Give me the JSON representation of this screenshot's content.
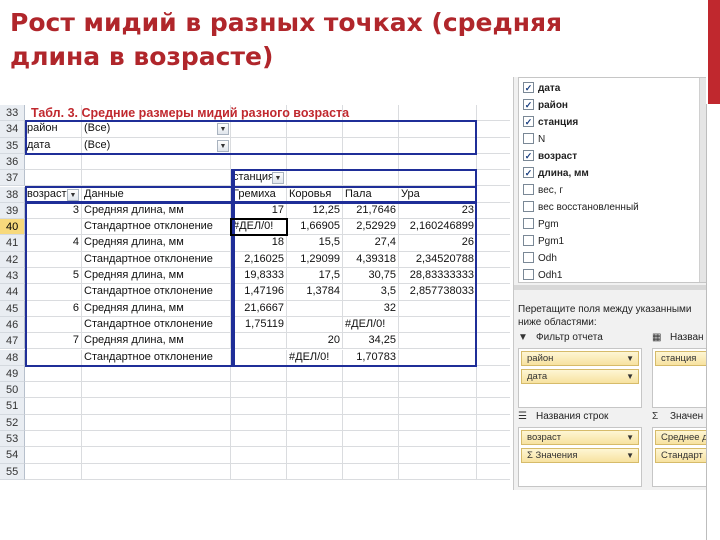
{
  "slide": {
    "title": "Рост мидий в разных точках (средняя длина в возрасте)"
  },
  "sheet": {
    "pivot_title": "Табл. 3. Средние размеры мидий разного возраста",
    "filters": [
      {
        "row": "34",
        "field": "район",
        "value": "(Все)"
      },
      {
        "row": "35",
        "field": "дата",
        "value": "(Все)"
      }
    ],
    "blank_rows": [
      "33",
      "36"
    ],
    "col_field_row": {
      "row": "37",
      "label": "станция"
    },
    "header_row": {
      "row": "38",
      "row_field": "возраст",
      "data_label": "Данные",
      "columns": [
        "Гремиха",
        "Коровья",
        "Пала",
        "Ура"
      ]
    },
    "data_rows": [
      {
        "row": "39",
        "age": "3",
        "measure": "Средняя длина, мм",
        "values": [
          "17",
          "12,25",
          "21,7646",
          "23"
        ]
      },
      {
        "row": "40",
        "age": "",
        "measure": "Стандартное отклонение",
        "values": [
          "#ДЕЛ/0!",
          "1,66905",
          "2,52929",
          "2,160246899"
        ]
      },
      {
        "row": "41",
        "age": "4",
        "measure": "Средняя длина, мм",
        "values": [
          "18",
          "15,5",
          "27,4",
          "26"
        ]
      },
      {
        "row": "42",
        "age": "",
        "measure": "Стандартное отклонение",
        "values": [
          "2,16025",
          "1,29099",
          "4,39318",
          "2,34520788"
        ]
      },
      {
        "row": "43",
        "age": "5",
        "measure": "Средняя длина, мм",
        "values": [
          "19,8333",
          "17,5",
          "30,75",
          "28,83333333"
        ]
      },
      {
        "row": "44",
        "age": "",
        "measure": "Стандартное отклонение",
        "values": [
          "1,47196",
          "1,3784",
          "3,5",
          "2,857738033"
        ]
      },
      {
        "row": "45",
        "age": "6",
        "measure": "Средняя длина, мм",
        "values": [
          "21,6667",
          "",
          "32",
          ""
        ]
      },
      {
        "row": "46",
        "age": "",
        "measure": "Стандартное отклонение",
        "values": [
          "1,75119",
          "",
          "#ДЕЛ/0!",
          ""
        ]
      },
      {
        "row": "47",
        "age": "7",
        "measure": "Средняя длина, мм",
        "values": [
          "",
          "20",
          "34,25",
          ""
        ]
      },
      {
        "row": "48",
        "age": "",
        "measure": "Стандартное отклонение",
        "values": [
          "",
          "#ДЕЛ/0!",
          "1,70783",
          ""
        ]
      }
    ],
    "trailing_rows": [
      "49",
      "50",
      "51",
      "52",
      "53",
      "54",
      "55"
    ],
    "selected_row": "40",
    "accent_color": "#c0282e",
    "border_color": "#1f2e98"
  },
  "pane": {
    "fields": [
      {
        "label": "дата",
        "checked": true
      },
      {
        "label": "район",
        "checked": true
      },
      {
        "label": "станция",
        "checked": true
      },
      {
        "label": "N",
        "checked": false
      },
      {
        "label": "возраст",
        "checked": true
      },
      {
        "label": "длина, мм",
        "checked": true
      },
      {
        "label": "вес, г",
        "checked": false
      },
      {
        "label": "вес восстановленный",
        "checked": false
      },
      {
        "label": "Pgm",
        "checked": false
      },
      {
        "label": "Pgm1",
        "checked": false
      },
      {
        "label": "Odh",
        "checked": false
      },
      {
        "label": "Odh1",
        "checked": false
      }
    ],
    "hint": "Перетащите поля между указанными ниже областями:",
    "report_filter": {
      "label": "Фильтр отчета",
      "items": [
        "район",
        "дата"
      ]
    },
    "column_labels": {
      "label": "Назван",
      "items": [
        "станция"
      ]
    },
    "row_labels": {
      "label": "Названия строк",
      "items": [
        "возраст",
        "Σ Значения"
      ]
    },
    "values": {
      "label": "Значен",
      "items": [
        "Среднее д",
        "Стандарт"
      ]
    }
  }
}
